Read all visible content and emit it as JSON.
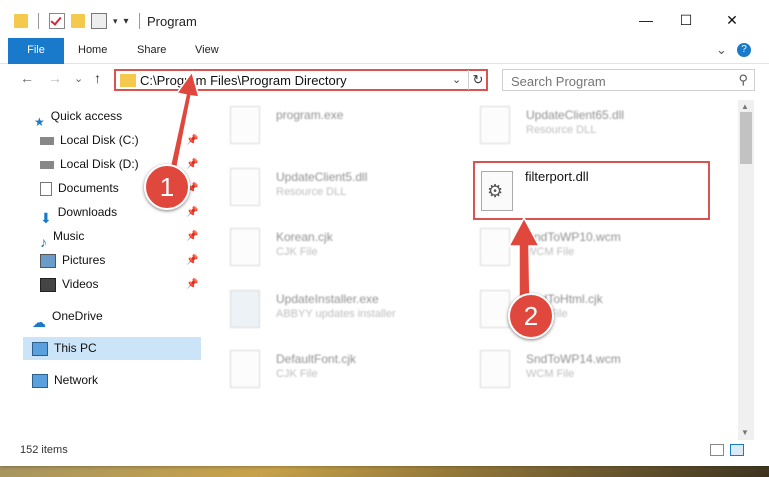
{
  "window": {
    "title": "Program",
    "minimize": "—",
    "maximize": "☐",
    "close": "✕"
  },
  "ribbon": {
    "tabs": [
      "File",
      "Home",
      "Share",
      "View"
    ],
    "collapse": "⌄",
    "help": "?"
  },
  "address": {
    "path": "C:\\Program Files\\Program Directory",
    "dropdown": "⌄",
    "refresh": "↻"
  },
  "nav_buttons": {
    "back": "←",
    "forward": "→",
    "recent": "⌄",
    "up": "↑"
  },
  "search": {
    "placeholder": "Search Program",
    "icon": "⚲"
  },
  "sidebar": {
    "items": [
      {
        "label": "Quick access",
        "icon": "star-icon"
      },
      {
        "label": "Local Disk (C:)",
        "icon": "drive-icon",
        "pinned": true
      },
      {
        "label": "Local Disk (D:)",
        "icon": "drive-icon",
        "pinned": true
      },
      {
        "label": "Documents",
        "icon": "documents-icon",
        "pinned": true
      },
      {
        "label": "Downloads",
        "icon": "download-icon",
        "pinned": true
      },
      {
        "label": "Music",
        "icon": "music-icon",
        "pinned": true
      },
      {
        "label": "Pictures",
        "icon": "pictures-icon",
        "pinned": true
      },
      {
        "label": "Videos",
        "icon": "videos-icon",
        "pinned": true
      },
      {
        "label": "OneDrive",
        "icon": "cloud-icon"
      },
      {
        "label": "This PC",
        "icon": "computer-icon",
        "selected": true
      },
      {
        "label": "Network",
        "icon": "network-icon"
      }
    ],
    "pin_glyph": "📌"
  },
  "files": [
    {
      "name": "program.exe",
      "type": ""
    },
    {
      "name": "UpdateClient65.dll",
      "type": "Resource DLL"
    },
    {
      "name": "UpdateClient5.dll",
      "type": "Resource DLL"
    },
    {
      "name": "Korean.cjk",
      "type": "CJK File"
    },
    {
      "name": "SndToWP10.wcm",
      "type": "WCM File"
    },
    {
      "name": "UpdateInstaller.exe",
      "type": "ABBYY updates installer"
    },
    {
      "name": "SndToHtml.cjk",
      "type": "CJK File"
    },
    {
      "name": "DefaultFont.cjk",
      "type": "CJK File"
    },
    {
      "name": "SndToWP14.wcm",
      "type": "WCM File"
    }
  ],
  "highlighted_file": {
    "name": "filterport.dll",
    "icon": "dll-gear-icon"
  },
  "markers": {
    "one": "1",
    "two": "2"
  },
  "status": {
    "item_count": "152 items"
  },
  "colors": {
    "accent": "#1979ca",
    "highlight": "#d9534f",
    "selection": "#cce4f7"
  }
}
